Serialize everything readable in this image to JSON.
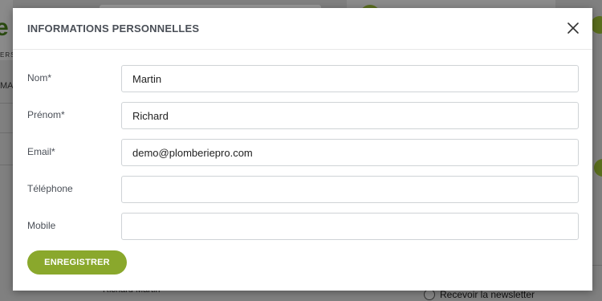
{
  "background": {
    "logo_letter": "e",
    "tagline": "ERSI",
    "nav_fragment": "MA",
    "user_name": "Richard Martin",
    "newsletter_label": "Recevoir la newsletter"
  },
  "modal": {
    "title": "INFORMATIONS PERSONNELLES",
    "close_icon": "close-icon",
    "fields": [
      {
        "label": "Nom",
        "required_mark": "*",
        "value": "Martin"
      },
      {
        "label": "Prénom",
        "required_mark": "*",
        "value": "Richard"
      },
      {
        "label": "Email",
        "required_mark": "*",
        "value": "demo@plomberiepro.com"
      },
      {
        "label": "Téléphone",
        "required_mark": "",
        "value": ""
      },
      {
        "label": "Mobile",
        "required_mark": "",
        "value": ""
      }
    ],
    "save_label": "ENREGISTRER"
  },
  "colors": {
    "accent": "#8aa82c",
    "title_text": "#4a4f57",
    "input_border": "#cfd3d6"
  }
}
